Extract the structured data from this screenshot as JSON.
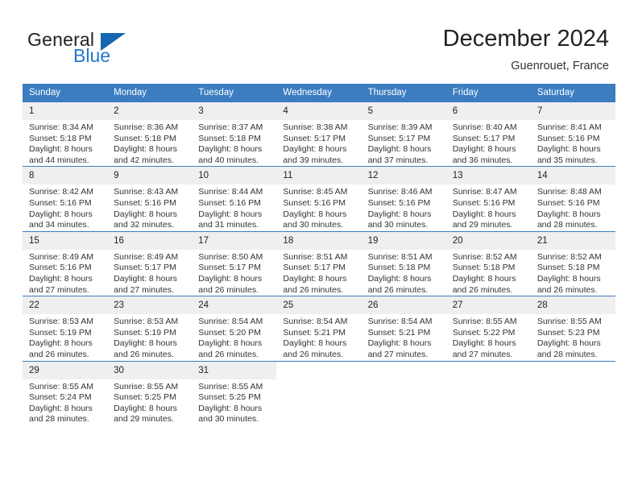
{
  "brand": {
    "name_primary": "General",
    "name_secondary": "Blue",
    "logo_icon": "blue-triangle-flag-icon"
  },
  "header": {
    "title": "December 2024",
    "subtitle": "Guenrouet, France"
  },
  "colors": {
    "header_blue": "#3b7dc0",
    "daynum_band": "#efefef",
    "brand_blue": "#2277c8",
    "text": "#333333"
  },
  "calendar": {
    "weekday_headers": [
      "Sunday",
      "Monday",
      "Tuesday",
      "Wednesday",
      "Thursday",
      "Friday",
      "Saturday"
    ],
    "weeks": [
      [
        {
          "day": "1",
          "sunrise": "Sunrise: 8:34 AM",
          "sunset": "Sunset: 5:18 PM",
          "daylight_1": "Daylight: 8 hours",
          "daylight_2": "and 44 minutes."
        },
        {
          "day": "2",
          "sunrise": "Sunrise: 8:36 AM",
          "sunset": "Sunset: 5:18 PM",
          "daylight_1": "Daylight: 8 hours",
          "daylight_2": "and 42 minutes."
        },
        {
          "day": "3",
          "sunrise": "Sunrise: 8:37 AM",
          "sunset": "Sunset: 5:18 PM",
          "daylight_1": "Daylight: 8 hours",
          "daylight_2": "and 40 minutes."
        },
        {
          "day": "4",
          "sunrise": "Sunrise: 8:38 AM",
          "sunset": "Sunset: 5:17 PM",
          "daylight_1": "Daylight: 8 hours",
          "daylight_2": "and 39 minutes."
        },
        {
          "day": "5",
          "sunrise": "Sunrise: 8:39 AM",
          "sunset": "Sunset: 5:17 PM",
          "daylight_1": "Daylight: 8 hours",
          "daylight_2": "and 37 minutes."
        },
        {
          "day": "6",
          "sunrise": "Sunrise: 8:40 AM",
          "sunset": "Sunset: 5:17 PM",
          "daylight_1": "Daylight: 8 hours",
          "daylight_2": "and 36 minutes."
        },
        {
          "day": "7",
          "sunrise": "Sunrise: 8:41 AM",
          "sunset": "Sunset: 5:16 PM",
          "daylight_1": "Daylight: 8 hours",
          "daylight_2": "and 35 minutes."
        }
      ],
      [
        {
          "day": "8",
          "sunrise": "Sunrise: 8:42 AM",
          "sunset": "Sunset: 5:16 PM",
          "daylight_1": "Daylight: 8 hours",
          "daylight_2": "and 34 minutes."
        },
        {
          "day": "9",
          "sunrise": "Sunrise: 8:43 AM",
          "sunset": "Sunset: 5:16 PM",
          "daylight_1": "Daylight: 8 hours",
          "daylight_2": "and 32 minutes."
        },
        {
          "day": "10",
          "sunrise": "Sunrise: 8:44 AM",
          "sunset": "Sunset: 5:16 PM",
          "daylight_1": "Daylight: 8 hours",
          "daylight_2": "and 31 minutes."
        },
        {
          "day": "11",
          "sunrise": "Sunrise: 8:45 AM",
          "sunset": "Sunset: 5:16 PM",
          "daylight_1": "Daylight: 8 hours",
          "daylight_2": "and 30 minutes."
        },
        {
          "day": "12",
          "sunrise": "Sunrise: 8:46 AM",
          "sunset": "Sunset: 5:16 PM",
          "daylight_1": "Daylight: 8 hours",
          "daylight_2": "and 30 minutes."
        },
        {
          "day": "13",
          "sunrise": "Sunrise: 8:47 AM",
          "sunset": "Sunset: 5:16 PM",
          "daylight_1": "Daylight: 8 hours",
          "daylight_2": "and 29 minutes."
        },
        {
          "day": "14",
          "sunrise": "Sunrise: 8:48 AM",
          "sunset": "Sunset: 5:16 PM",
          "daylight_1": "Daylight: 8 hours",
          "daylight_2": "and 28 minutes."
        }
      ],
      [
        {
          "day": "15",
          "sunrise": "Sunrise: 8:49 AM",
          "sunset": "Sunset: 5:16 PM",
          "daylight_1": "Daylight: 8 hours",
          "daylight_2": "and 27 minutes."
        },
        {
          "day": "16",
          "sunrise": "Sunrise: 8:49 AM",
          "sunset": "Sunset: 5:17 PM",
          "daylight_1": "Daylight: 8 hours",
          "daylight_2": "and 27 minutes."
        },
        {
          "day": "17",
          "sunrise": "Sunrise: 8:50 AM",
          "sunset": "Sunset: 5:17 PM",
          "daylight_1": "Daylight: 8 hours",
          "daylight_2": "and 26 minutes."
        },
        {
          "day": "18",
          "sunrise": "Sunrise: 8:51 AM",
          "sunset": "Sunset: 5:17 PM",
          "daylight_1": "Daylight: 8 hours",
          "daylight_2": "and 26 minutes."
        },
        {
          "day": "19",
          "sunrise": "Sunrise: 8:51 AM",
          "sunset": "Sunset: 5:18 PM",
          "daylight_1": "Daylight: 8 hours",
          "daylight_2": "and 26 minutes."
        },
        {
          "day": "20",
          "sunrise": "Sunrise: 8:52 AM",
          "sunset": "Sunset: 5:18 PM",
          "daylight_1": "Daylight: 8 hours",
          "daylight_2": "and 26 minutes."
        },
        {
          "day": "21",
          "sunrise": "Sunrise: 8:52 AM",
          "sunset": "Sunset: 5:18 PM",
          "daylight_1": "Daylight: 8 hours",
          "daylight_2": "and 26 minutes."
        }
      ],
      [
        {
          "day": "22",
          "sunrise": "Sunrise: 8:53 AM",
          "sunset": "Sunset: 5:19 PM",
          "daylight_1": "Daylight: 8 hours",
          "daylight_2": "and 26 minutes."
        },
        {
          "day": "23",
          "sunrise": "Sunrise: 8:53 AM",
          "sunset": "Sunset: 5:19 PM",
          "daylight_1": "Daylight: 8 hours",
          "daylight_2": "and 26 minutes."
        },
        {
          "day": "24",
          "sunrise": "Sunrise: 8:54 AM",
          "sunset": "Sunset: 5:20 PM",
          "daylight_1": "Daylight: 8 hours",
          "daylight_2": "and 26 minutes."
        },
        {
          "day": "25",
          "sunrise": "Sunrise: 8:54 AM",
          "sunset": "Sunset: 5:21 PM",
          "daylight_1": "Daylight: 8 hours",
          "daylight_2": "and 26 minutes."
        },
        {
          "day": "26",
          "sunrise": "Sunrise: 8:54 AM",
          "sunset": "Sunset: 5:21 PM",
          "daylight_1": "Daylight: 8 hours",
          "daylight_2": "and 27 minutes."
        },
        {
          "day": "27",
          "sunrise": "Sunrise: 8:55 AM",
          "sunset": "Sunset: 5:22 PM",
          "daylight_1": "Daylight: 8 hours",
          "daylight_2": "and 27 minutes."
        },
        {
          "day": "28",
          "sunrise": "Sunrise: 8:55 AM",
          "sunset": "Sunset: 5:23 PM",
          "daylight_1": "Daylight: 8 hours",
          "daylight_2": "and 28 minutes."
        }
      ],
      [
        {
          "day": "29",
          "sunrise": "Sunrise: 8:55 AM",
          "sunset": "Sunset: 5:24 PM",
          "daylight_1": "Daylight: 8 hours",
          "daylight_2": "and 28 minutes."
        },
        {
          "day": "30",
          "sunrise": "Sunrise: 8:55 AM",
          "sunset": "Sunset: 5:25 PM",
          "daylight_1": "Daylight: 8 hours",
          "daylight_2": "and 29 minutes."
        },
        {
          "day": "31",
          "sunrise": "Sunrise: 8:55 AM",
          "sunset": "Sunset: 5:25 PM",
          "daylight_1": "Daylight: 8 hours",
          "daylight_2": "and 30 minutes."
        },
        {
          "day": "",
          "sunrise": "",
          "sunset": "",
          "daylight_1": "",
          "daylight_2": ""
        },
        {
          "day": "",
          "sunrise": "",
          "sunset": "",
          "daylight_1": "",
          "daylight_2": ""
        },
        {
          "day": "",
          "sunrise": "",
          "sunset": "",
          "daylight_1": "",
          "daylight_2": ""
        },
        {
          "day": "",
          "sunrise": "",
          "sunset": "",
          "daylight_1": "",
          "daylight_2": ""
        }
      ]
    ]
  }
}
